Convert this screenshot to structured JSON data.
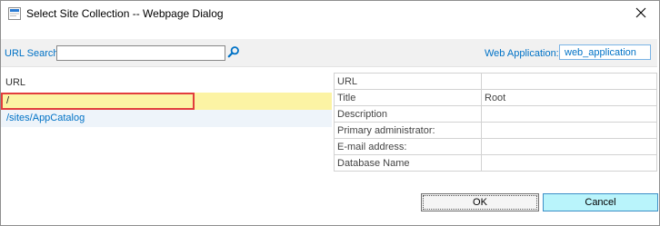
{
  "window": {
    "title": "Select Site Collection -- Webpage Dialog"
  },
  "search": {
    "label": "URL Search",
    "value": ""
  },
  "web_application": {
    "label": "Web Application:",
    "value": "web_application"
  },
  "url_list": {
    "header": "URL",
    "items": [
      {
        "url": "/",
        "selected": true
      },
      {
        "url": "/sites/AppCatalog",
        "selected": false
      }
    ]
  },
  "properties": [
    {
      "label": "URL",
      "value": ""
    },
    {
      "label": "Title",
      "value": "Root"
    },
    {
      "label": "Description",
      "value": ""
    },
    {
      "label": "Primary administrator:",
      "value": ""
    },
    {
      "label": "E-mail address:",
      "value": ""
    },
    {
      "label": "Database Name",
      "value": ""
    }
  ],
  "buttons": {
    "ok": "OK",
    "cancel": "Cancel"
  },
  "colors": {
    "link": "#0072c6",
    "selected_row": "#fcf3a4",
    "highlight_border": "#e23d3d",
    "cancel_button": "#b9f4fb"
  }
}
